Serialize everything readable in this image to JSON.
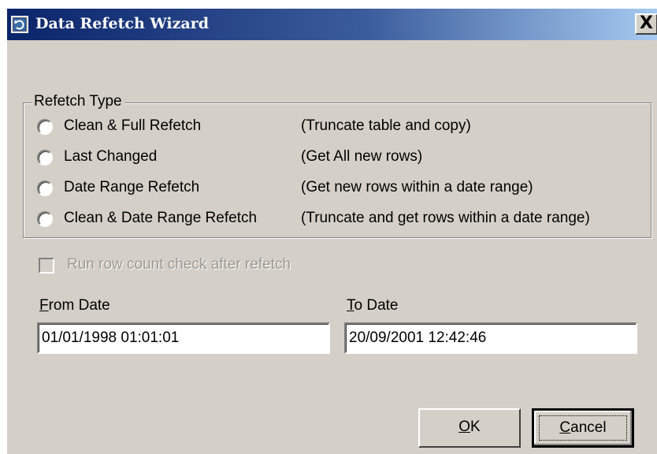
{
  "window": {
    "title": "Data Refetch Wizard",
    "close_label": "X"
  },
  "refetch_type": {
    "legend": "Refetch Type",
    "options": [
      {
        "label": "Clean & Full Refetch",
        "description": "(Truncate table and copy)"
      },
      {
        "label": "Last Changed",
        "description": "(Get All new rows)"
      },
      {
        "label": "Date Range Refetch",
        "description": "(Get new rows within a date range)"
      },
      {
        "label": "Clean & Date Range Refetch",
        "description": "(Truncate and get rows within a date range)"
      }
    ]
  },
  "row_count_check": {
    "label": "Run row count check after refetch",
    "checked": false,
    "enabled": false
  },
  "from_date": {
    "label_accel": "F",
    "label_rest": "rom Date",
    "value": "01/01/1998 01:01:01"
  },
  "to_date": {
    "label_accel": "T",
    "label_rest": "o Date",
    "value": "20/09/2001 12:42:46"
  },
  "buttons": {
    "ok_accel": "O",
    "ok_rest": "K",
    "cancel_accel": "C",
    "cancel_rest": "ancel"
  },
  "icons": {
    "app": "refresh-icon",
    "close": "close-icon"
  },
  "colors": {
    "titlebar_start": "#0a246a",
    "titlebar_end": "#a6caf0",
    "face": "#d4d0c8",
    "disabled_text": "#9c9a94"
  }
}
